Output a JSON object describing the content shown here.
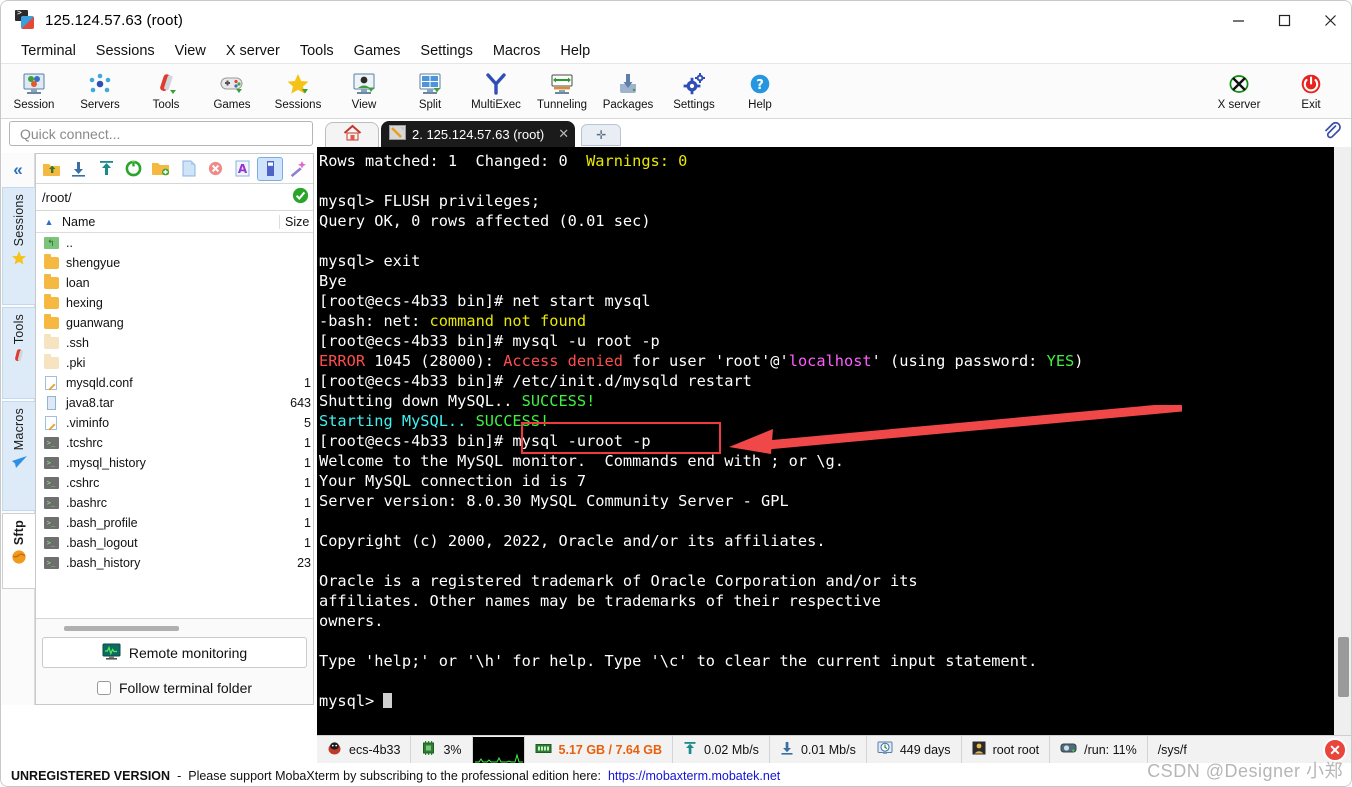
{
  "window": {
    "title": "125.124.57.63 (root)",
    "app_icon": "mobaxterm-icon",
    "controls": {
      "minimize": "—",
      "maximize": "▢",
      "close": "✕"
    }
  },
  "menubar": {
    "items": [
      "Terminal",
      "Sessions",
      "View",
      "X server",
      "Tools",
      "Games",
      "Settings",
      "Macros",
      "Help"
    ]
  },
  "toolbar": {
    "left_items": [
      {
        "label": "Session",
        "icon": "session-icon"
      },
      {
        "label": "Servers",
        "icon": "servers-icon"
      },
      {
        "label": "Tools",
        "icon": "tools-icon"
      },
      {
        "label": "Games",
        "icon": "games-icon"
      },
      {
        "label": "Sessions",
        "icon": "sessions-star-icon"
      },
      {
        "label": "View",
        "icon": "view-icon"
      },
      {
        "label": "Split",
        "icon": "split-icon"
      },
      {
        "label": "MultiExec",
        "icon": "multiexec-icon"
      },
      {
        "label": "Tunneling",
        "icon": "tunneling-icon"
      },
      {
        "label": "Packages",
        "icon": "packages-icon"
      },
      {
        "label": "Settings",
        "icon": "settings-gear-icon"
      },
      {
        "label": "Help",
        "icon": "help-icon"
      }
    ],
    "right_items": [
      {
        "label": "X server",
        "icon": "xserver-icon"
      },
      {
        "label": "Exit",
        "icon": "power-exit-icon"
      }
    ]
  },
  "quick_connect": {
    "placeholder": "Quick connect..."
  },
  "rail": {
    "collapse": "«",
    "tabs": [
      {
        "label": "Sessions",
        "icon": "star-icon",
        "active": false
      },
      {
        "label": "Tools",
        "icon": "tools-knife-icon",
        "active": false
      },
      {
        "label": "Macros",
        "icon": "paper-plane-icon",
        "active": false
      },
      {
        "label": "Sftp",
        "icon": "globe-icon",
        "active": true
      }
    ]
  },
  "file_browser": {
    "toolbar_buttons": [
      {
        "name": "go-up-icon",
        "glyph": "↰"
      },
      {
        "name": "download-icon",
        "glyph": "⭳"
      },
      {
        "name": "upload-icon",
        "glyph": "⭱"
      },
      {
        "name": "refresh-icon",
        "glyph": "⟳"
      },
      {
        "name": "new-folder-icon",
        "glyph": "🗀"
      },
      {
        "name": "new-file-icon",
        "glyph": "🗎"
      },
      {
        "name": "delete-icon",
        "glyph": "✖"
      },
      {
        "name": "text-view-icon",
        "glyph": "A"
      },
      {
        "name": "details-toggle-icon",
        "glyph": "▮",
        "active": true
      },
      {
        "name": "magic-wand-icon",
        "glyph": "✨"
      }
    ],
    "path": "/root/",
    "path_status": "connected-ok",
    "columns": [
      "Name",
      "Size"
    ],
    "sort_indicator": "▲",
    "rows": [
      {
        "icon": "parent-dir-icon",
        "name": "..",
        "size": ""
      },
      {
        "icon": "folder-icon",
        "name": "shengyue",
        "size": ""
      },
      {
        "icon": "folder-icon",
        "name": "loan",
        "size": ""
      },
      {
        "icon": "folder-icon",
        "name": "hexing",
        "size": ""
      },
      {
        "icon": "folder-icon",
        "name": "guanwang",
        "size": ""
      },
      {
        "icon": "folder-pale-icon",
        "name": ".ssh",
        "size": ""
      },
      {
        "icon": "folder-pale-icon",
        "name": ".pki",
        "size": ""
      },
      {
        "icon": "doc-icon",
        "name": "mysqld.conf",
        "size": "1"
      },
      {
        "icon": "archive-icon",
        "name": "java8.tar",
        "size": "643"
      },
      {
        "icon": "doc-icon",
        "name": ".viminfo",
        "size": "5"
      },
      {
        "icon": "shell-icon",
        "name": ".tcshrc",
        "size": "1"
      },
      {
        "icon": "shell-icon",
        "name": ".mysql_history",
        "size": "1"
      },
      {
        "icon": "shell-icon",
        "name": ".cshrc",
        "size": "1"
      },
      {
        "icon": "shell-icon",
        "name": ".bashrc",
        "size": "1"
      },
      {
        "icon": "shell-icon",
        "name": ".bash_profile",
        "size": "1"
      },
      {
        "icon": "shell-icon",
        "name": ".bash_logout",
        "size": "1"
      },
      {
        "icon": "shell-icon",
        "name": ".bash_history",
        "size": "23"
      }
    ],
    "remote_monitoring": "Remote monitoring",
    "follow_terminal_folder": "Follow terminal folder",
    "follow_checked": false
  },
  "tabstrip": {
    "home_tab_icon": "home-icon",
    "session_tab": {
      "icon": "terminal-tab-icon",
      "label": "2. 125.124.57.63 (root)",
      "close": "✕"
    },
    "new_tab": "✛",
    "clipboard_icon": "paperclip-icon"
  },
  "terminal": {
    "lines": [
      [
        {
          "t": "Rows matched: 1  Changed: 0  ",
          "c": "white"
        },
        {
          "t": "Warnings: 0",
          "c": "yellow"
        }
      ],
      [],
      [
        {
          "t": "mysql> FLUSH privileges;",
          "c": "white"
        }
      ],
      [
        {
          "t": "Query OK, 0 rows affected (0.01 sec)",
          "c": "white"
        }
      ],
      [],
      [
        {
          "t": "mysql> exit",
          "c": "white"
        }
      ],
      [
        {
          "t": "Bye",
          "c": "white"
        }
      ],
      [
        {
          "t": "[root@ecs-4b33 bin]# net start mysql",
          "c": "white"
        }
      ],
      [
        {
          "t": "-bash: net: ",
          "c": "white"
        },
        {
          "t": "command not found",
          "c": "yellow"
        }
      ],
      [
        {
          "t": "[root@ecs-4b33 bin]# mysql -u root -p",
          "c": "white"
        }
      ],
      [
        {
          "t": "ERROR",
          "c": "red"
        },
        {
          "t": " 1045 (28000): ",
          "c": "white"
        },
        {
          "t": "Access denied",
          "c": "red"
        },
        {
          "t": " for user 'root'@'",
          "c": "white"
        },
        {
          "t": "localhost",
          "c": "magenta"
        },
        {
          "t": "' (using password: ",
          "c": "white"
        },
        {
          "t": "YES",
          "c": "green"
        },
        {
          "t": ")",
          "c": "white"
        }
      ],
      [
        {
          "t": "[root@ecs-4b33 bin]# /etc/init.d/mysqld restart",
          "c": "white"
        }
      ],
      [
        {
          "t": "Shutting down MySQL.. ",
          "c": "white"
        },
        {
          "t": "SUCCESS!",
          "c": "green"
        }
      ],
      [
        {
          "t": "Starting MySQL.. ",
          "c": "cyan"
        },
        {
          "t": "SUCCESS!",
          "c": "green"
        }
      ],
      [
        {
          "t": "[root@ecs-4b33 bin]# mysql -uroot -p",
          "c": "white"
        }
      ],
      [
        {
          "t": "Welcome to the MySQL monitor.  Commands end with ; or \\g.",
          "c": "white"
        }
      ],
      [
        {
          "t": "Your MySQL connection id is 7",
          "c": "white"
        }
      ],
      [
        {
          "t": "Server version: 8.0.30 MySQL Community Server - GPL",
          "c": "white"
        }
      ],
      [],
      [
        {
          "t": "Copyright (c) 2000, 2022, Oracle and/or its affiliates.",
          "c": "white"
        }
      ],
      [],
      [
        {
          "t": "Oracle is a registered trademark of Oracle Corporation and/or its",
          "c": "white"
        }
      ],
      [
        {
          "t": "affiliates. Other names may be trademarks of their respective",
          "c": "white"
        }
      ],
      [
        {
          "t": "owners.",
          "c": "white"
        }
      ],
      [],
      [
        {
          "t": "Type 'help;' or '\\h' for help. Type '\\c' to clear the current input statement.",
          "c": "white"
        }
      ],
      [],
      [
        {
          "t": "mysql> ",
          "c": "white"
        },
        {
          "t": "CURSOR",
          "c": "cursor"
        }
      ]
    ],
    "annotation": {
      "highlighted_command": "mysql -uroot -p",
      "box_color": "#ef3b3b",
      "arrow_color": "#f04848"
    }
  },
  "statusbar": {
    "cells": [
      {
        "icon": "linux-host-icon",
        "label": "ecs-4b33",
        "style": "normal"
      },
      {
        "icon": "cpu-icon",
        "label": "3%",
        "style": "normal"
      },
      {
        "icon": "cpu-graph",
        "label": "",
        "style": "graph"
      },
      {
        "icon": "memory-icon",
        "label": "5.17 GB / 7.64 GB",
        "style": "mem"
      },
      {
        "icon": "upload-arrow-icon",
        "label": "0.02 Mb/s",
        "style": "normal"
      },
      {
        "icon": "download-arrow-icon",
        "label": "0.01 Mb/s",
        "style": "normal"
      },
      {
        "icon": "uptime-clock-icon",
        "label": "449 days",
        "style": "normal"
      },
      {
        "icon": "user-icon",
        "label": "root  root",
        "style": "normal"
      },
      {
        "icon": "disk-icon",
        "label": "/run: 11%",
        "style": "normal"
      },
      {
        "icon": "disk-icon",
        "label": "/sys/f",
        "style": "normal"
      }
    ],
    "close_badge": "✕"
  },
  "footer": {
    "unregistered": "UNREGISTERED VERSION",
    "dash": "-",
    "message": "Please support MobaXterm by subscribing to the professional edition here:",
    "link": "https://mobaxterm.mobatek.net"
  },
  "watermark": "CSDN @Designer 小郑",
  "colors": {
    "accent_blue": "#2f6fbf",
    "terminal_bg": "#000000",
    "annotation_red": "#ef3b3b",
    "mem_orange": "#e8600c",
    "link_blue": "#1414d6"
  }
}
